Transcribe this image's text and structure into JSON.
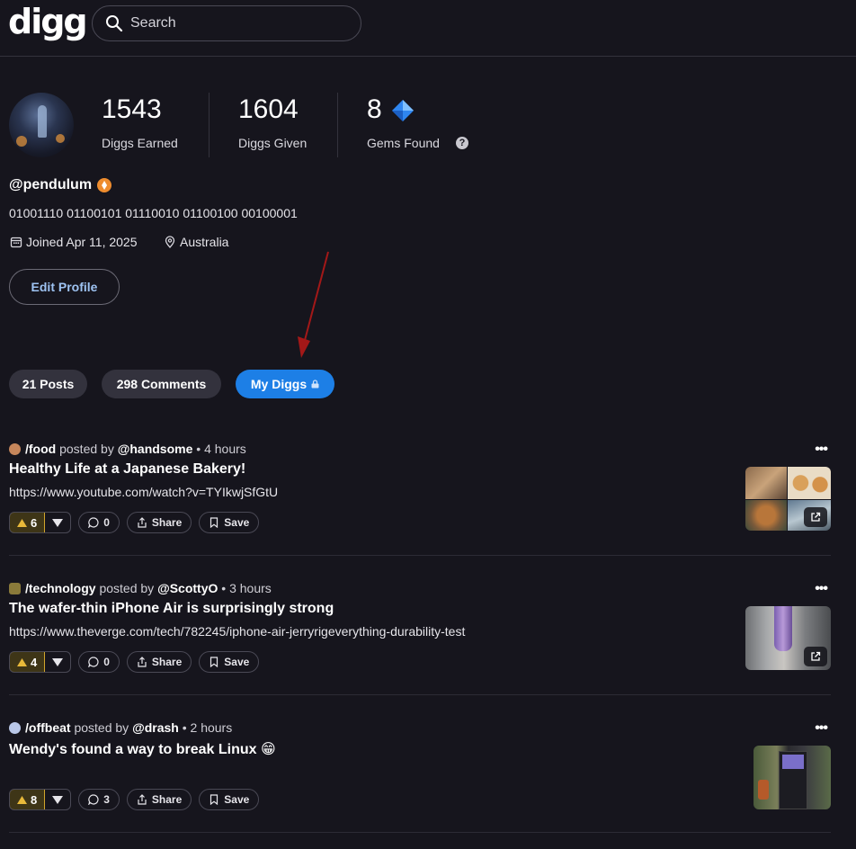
{
  "header": {
    "logo": "digg",
    "search_placeholder": "Search"
  },
  "profile": {
    "stats": [
      {
        "value": "1543",
        "label": "Diggs Earned"
      },
      {
        "value": "1604",
        "label": "Diggs Given"
      },
      {
        "value": "8",
        "label": "Gems Found"
      }
    ],
    "username": "@pendulum",
    "bio": "01001110 01100101 01110010 01100100 00100001",
    "joined": "Joined Apr 11, 2025",
    "location": "Australia",
    "edit_label": "Edit Profile"
  },
  "tabs": [
    {
      "label": "21 Posts"
    },
    {
      "label": "298 Comments"
    },
    {
      "label": "My Diggs"
    }
  ],
  "posts": [
    {
      "community": "/food",
      "posted_by": "posted by",
      "author": "@handsome",
      "time": "• 4 hours",
      "title": "Healthy Life at a Japanese Bakery!",
      "url": "https://www.youtube.com/watch?v=TYIkwjSfGtU",
      "diggs": "6",
      "comments": "0",
      "share": "Share",
      "save": "Save"
    },
    {
      "community": "/technology",
      "posted_by": "posted by",
      "author": "@ScottyO",
      "time": "• 3 hours",
      "title": "The wafer-thin iPhone Air is surprisingly strong",
      "url": "https://www.theverge.com/tech/782245/iphone-air-jerryrigeverything-durability-test",
      "diggs": "4",
      "comments": "0",
      "share": "Share",
      "save": "Save"
    },
    {
      "community": "/offbeat",
      "posted_by": "posted by",
      "author": "@drash",
      "time": "• 2 hours",
      "title": "Wendy's found a way to break Linux 😁",
      "url": "",
      "diggs": "8",
      "comments": "3",
      "share": "Share",
      "save": "Save"
    }
  ],
  "colors": {
    "background": "#16151d",
    "accent": "#1d7fe6",
    "digg_active": "#d1a52c",
    "annotation": "#a31818"
  }
}
